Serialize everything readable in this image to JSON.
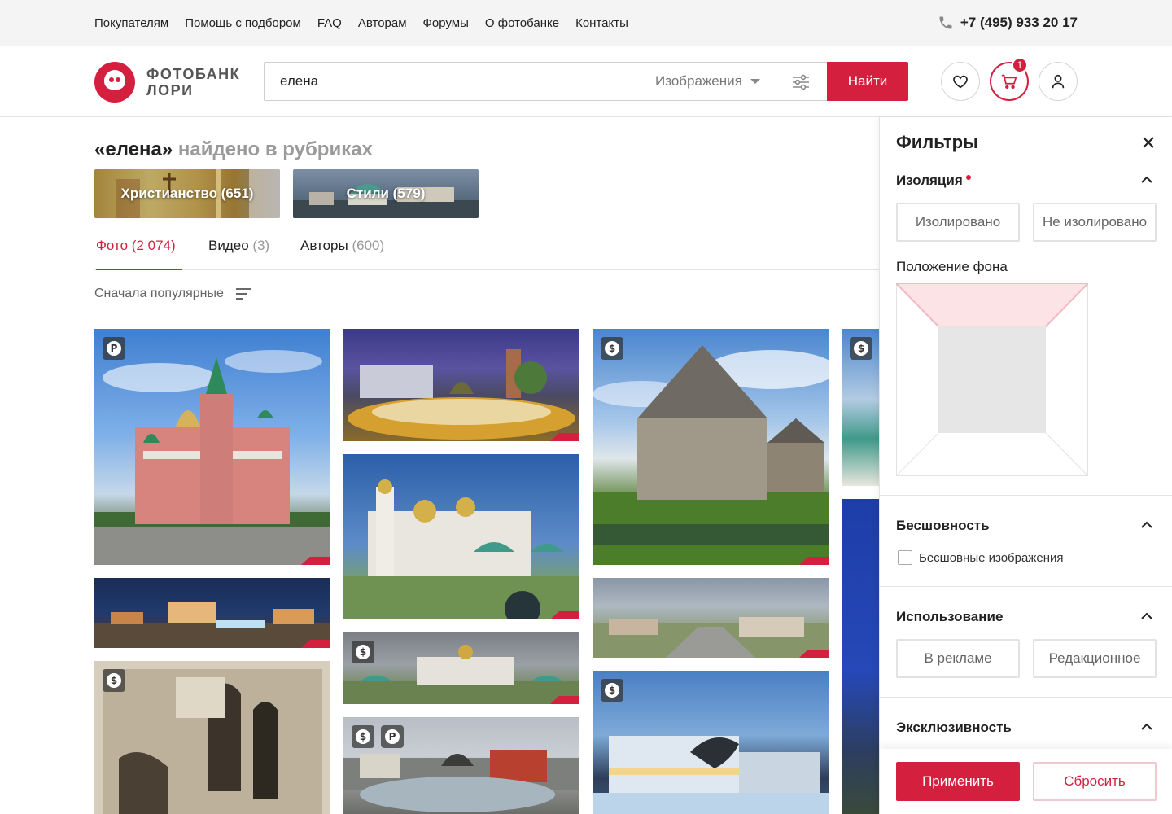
{
  "topbar": {
    "nav": [
      "Покупателям",
      "Помощь с подбором",
      "FAQ",
      "Авторам",
      "Форумы",
      "О фотобанке",
      "Контакты"
    ],
    "phone": "+7 (495) 933 20 17"
  },
  "logo": {
    "line1": "ФОТОБАНК",
    "line2": "ЛОРИ"
  },
  "search": {
    "query": "елена",
    "type": "Изображения",
    "button": "Найти"
  },
  "cart": {
    "count": "1"
  },
  "results": {
    "query": "«елена»",
    "suffix": "найдено в рубриках",
    "rubrics": [
      "Христианство (651)",
      "Стили (579)"
    ],
    "tabs": [
      {
        "label": "Фото",
        "count": "(2 074)"
      },
      {
        "label": "Видео",
        "count": "(3)"
      },
      {
        "label": "Авторы",
        "count": "(600)"
      }
    ],
    "sort": "Сначала популярные"
  },
  "photos": {
    "badges": [
      "P",
      "$",
      "$",
      "$",
      "$",
      "$",
      "P"
    ]
  },
  "filters": {
    "title": "Фильтры",
    "isolation": {
      "title": "Изоляция",
      "options": [
        "Изолировано",
        "Не изолировано"
      ]
    },
    "background": {
      "title": "Положение фона"
    },
    "seamless": {
      "title": "Бесшовность",
      "checkbox": "Бесшовные изображения"
    },
    "usage": {
      "title": "Использование",
      "options": [
        "В рекламе",
        "Редакционное"
      ]
    },
    "exclusive": {
      "title": "Эксклюзивность"
    },
    "apply": "Применить",
    "reset": "Сбросить"
  },
  "colors": {
    "accent": "#d51f3f",
    "muted": "#9a9a9a",
    "topbar": "#f4f4f4"
  }
}
